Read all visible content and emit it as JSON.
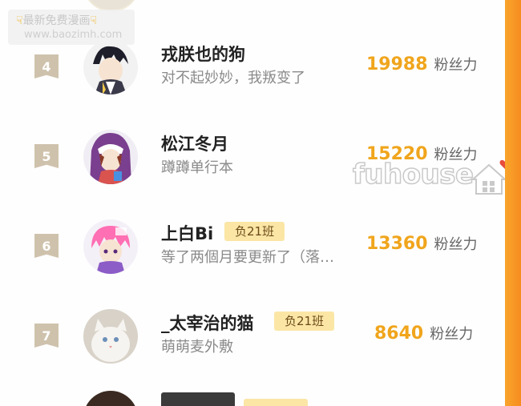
{
  "watermark": {
    "line1_text": "最新免费漫画",
    "line1_icon": "pointing-hand-icon",
    "line2": "www.baozimh.com"
  },
  "overlay": {
    "text": "fuhouse",
    "icon": "house-heart-icon"
  },
  "fans_label": "粉丝力",
  "rows": [
    {
      "rank": "4",
      "name": "戎朕也的狗",
      "desc": "对不起妙妙，我叛变了",
      "fans": "19988",
      "avatar": "avatar-icon",
      "avatar_color": "#2c2c3a"
    },
    {
      "rank": "5",
      "name": "松江冬月",
      "desc": "蹲蹲单行本",
      "fans": "15220",
      "avatar": "avatar-icon",
      "avatar_color": "#7a3f8f"
    },
    {
      "rank": "6",
      "name": "上白Bi",
      "tag": "负21班",
      "desc": "等了两個月要更新了（落…",
      "fans": "13360",
      "avatar": "avatar-icon",
      "avatar_color": "#ff6fb3"
    },
    {
      "rank": "7",
      "name": "_太宰治的猫",
      "tag": "负21班",
      "desc": "萌萌麦外敷",
      "fans": "8640",
      "avatar": "avatar-icon",
      "avatar_color": "#e8e2d8"
    }
  ],
  "colors": {
    "accent": "#f0a51c",
    "frame": "#f5a623",
    "rank_badge": "#cfc2ad",
    "tag_bg": "#fbe6a6"
  }
}
